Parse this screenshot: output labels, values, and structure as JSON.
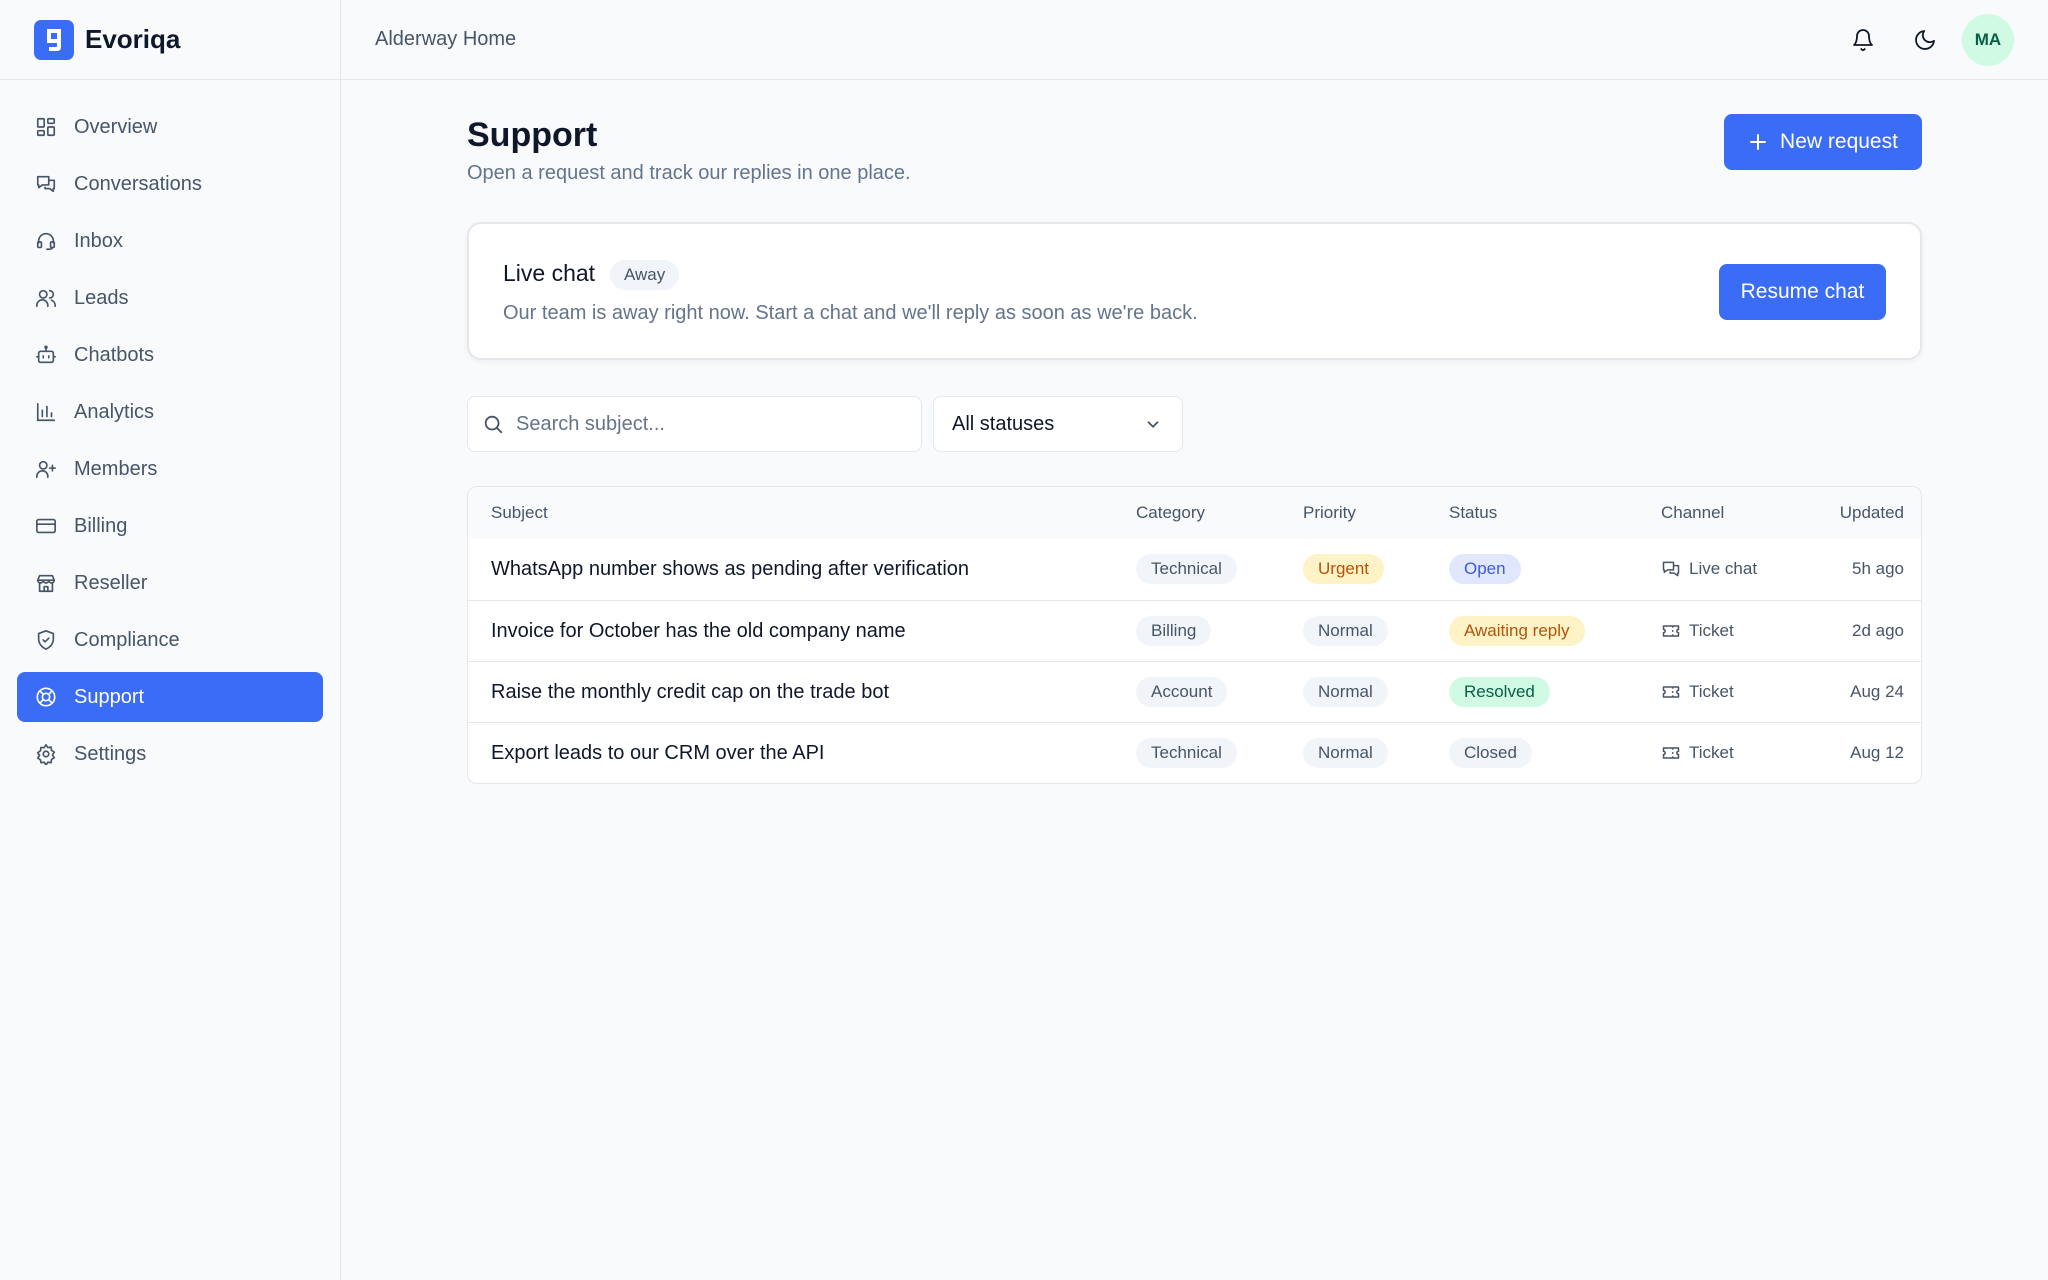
{
  "brand": {
    "name": "Evoriqa",
    "logo_letter": "g"
  },
  "workspace": "Alderway Home",
  "user": {
    "initials": "MA"
  },
  "sidebar": {
    "items": [
      {
        "label": "Overview",
        "icon": "grid-icon"
      },
      {
        "label": "Conversations",
        "icon": "chat-bubbles-icon"
      },
      {
        "label": "Inbox",
        "icon": "headset-icon"
      },
      {
        "label": "Leads",
        "icon": "users-icon"
      },
      {
        "label": "Chatbots",
        "icon": "bot-icon"
      },
      {
        "label": "Analytics",
        "icon": "bar-chart-icon"
      },
      {
        "label": "Members",
        "icon": "user-plus-icon"
      },
      {
        "label": "Billing",
        "icon": "credit-card-icon"
      },
      {
        "label": "Reseller",
        "icon": "store-icon"
      },
      {
        "label": "Compliance",
        "icon": "shield-check-icon"
      },
      {
        "label": "Support",
        "icon": "lifebuoy-icon",
        "active": true
      },
      {
        "label": "Settings",
        "icon": "gear-icon"
      }
    ]
  },
  "page": {
    "title": "Support",
    "subtitle": "Open a request and track our replies in one place.",
    "new_request_label": "New request"
  },
  "live_chat": {
    "title": "Live chat",
    "badge": "Away",
    "description": "Our team is away right now. Start a chat and we'll reply as soon as we're back.",
    "button_label": "Resume chat"
  },
  "filters": {
    "search_placeholder": "Search subject...",
    "status_selected": "All statuses"
  },
  "table": {
    "headers": [
      "Subject",
      "Category",
      "Priority",
      "Status",
      "Channel",
      "Updated"
    ],
    "rows": [
      {
        "subject": "WhatsApp number shows as pending after verification",
        "category": "Technical",
        "priority": "Urgent",
        "status": "Open",
        "channel": "Live chat",
        "updated": "5h ago"
      },
      {
        "subject": "Invoice for October has the old company name",
        "category": "Billing",
        "priority": "Normal",
        "status": "Awaiting reply",
        "channel": "Ticket",
        "updated": "2d ago"
      },
      {
        "subject": "Raise the monthly credit cap on the trade bot",
        "category": "Account",
        "priority": "Normal",
        "status": "Resolved",
        "channel": "Ticket",
        "updated": "Aug 24"
      },
      {
        "subject": "Export leads to our CRM over the API",
        "category": "Technical",
        "priority": "Normal",
        "status": "Closed",
        "channel": "Ticket",
        "updated": "Aug 12"
      }
    ]
  },
  "colors": {
    "accent": "#3b6cf5",
    "urgent_bg": "#fef3c7",
    "open_bg": "#e0e7ff",
    "resolved_bg": "#d1fae5"
  }
}
